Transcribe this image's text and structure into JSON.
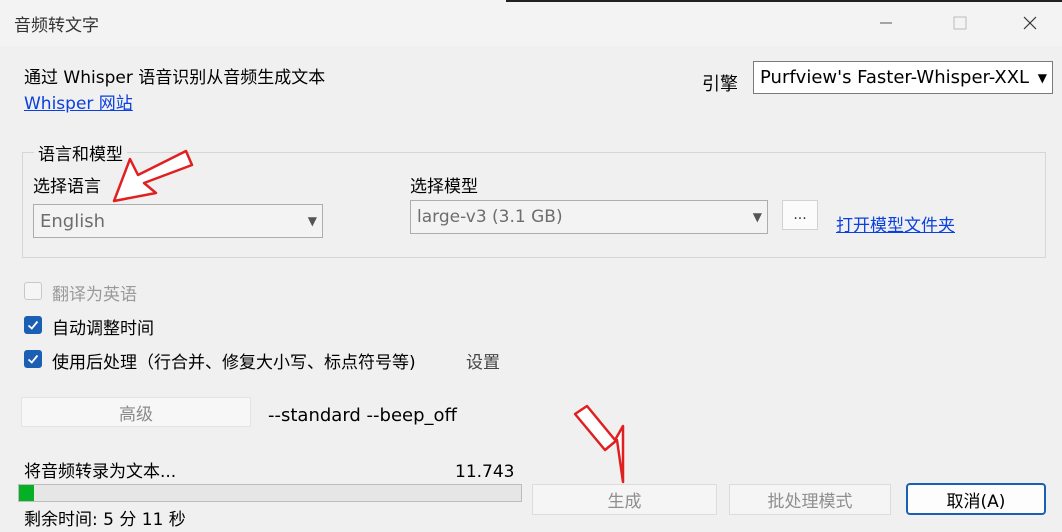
{
  "window": {
    "title": "音频转文字"
  },
  "header": {
    "description": "通过 Whisper 语音识别从音频生成文本",
    "site_link": "Whisper 网站",
    "engine_label": "引擎",
    "engine_value": "Purfview's Faster-Whisper-XXL"
  },
  "group": {
    "title": "语言和模型",
    "language_label": "选择语言",
    "language_value": "English",
    "model_label": "选择模型",
    "model_value": "large-v3 (3.1 GB)",
    "more_button": "...",
    "open_folder_link": "打开模型文件夹"
  },
  "options": {
    "translate": {
      "label": "翻译为英语",
      "checked": false,
      "enabled": false
    },
    "auto_adjust": {
      "label": "自动调整时间",
      "checked": true
    },
    "post_process": {
      "label": "使用后处理（行合并、修复大小写、标点符号等)",
      "checked": true
    },
    "settings_link": "设置"
  },
  "advanced": {
    "button_label": "高级",
    "args": "--standard --beep_off"
  },
  "progress": {
    "label": "将音频转录为文本...",
    "value_text": "11.743",
    "percent": 3,
    "remaining": "剩余时间: 5 分 11 秒"
  },
  "buttons": {
    "generate": "生成",
    "batch": "批处理模式",
    "cancel": "取消(A)"
  },
  "icons": {
    "minimize": "minimize-icon",
    "maximize": "maximize-icon",
    "close": "close-icon",
    "dropdown": "chevron-down-icon",
    "check": "check-icon"
  },
  "colors": {
    "accent": "#1a5fb4",
    "link": "#0a40e0",
    "progress": "#06b025",
    "annotation": "#e02020"
  }
}
